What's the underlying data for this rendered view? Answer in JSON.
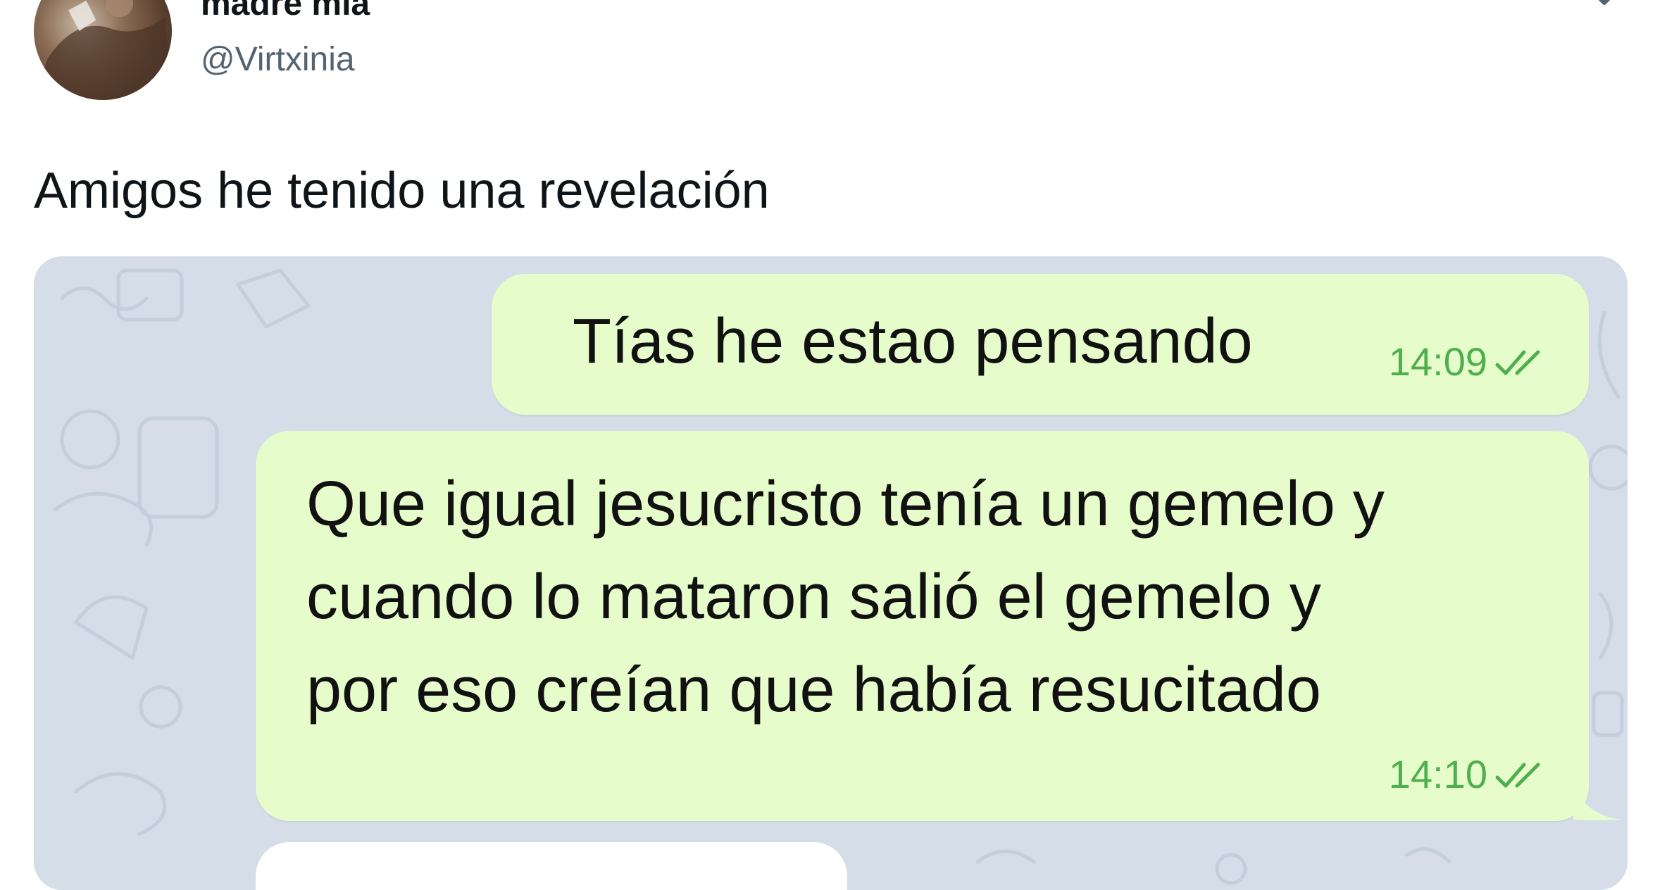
{
  "tweet": {
    "author": {
      "display_name": "madre mía",
      "handle": "@Virtxinia",
      "avatar_icon": "user-avatar"
    },
    "more_icon": "chevron-down-icon",
    "text": "Amigos he tenido una revelación"
  },
  "chat": {
    "background_color": "#d4dde8",
    "outgoing_bubble_color": "#e6fdcb",
    "incoming_bubble_color": "#ffffff",
    "status_color": "#4fae4e",
    "messages": [
      {
        "direction": "outgoing",
        "lines": [
          "Tías he estao pensando"
        ],
        "time": "14:09",
        "status_icon": "double-check-icon"
      },
      {
        "direction": "outgoing",
        "lines": [
          "Que igual jesucristo tenía un gemelo y",
          "cuando lo mataron salió el gemelo y",
          "por eso creían que había resucitado"
        ],
        "time": "14:10",
        "status_icon": "double-check-icon"
      },
      {
        "direction": "incoming",
        "lines": []
      }
    ]
  }
}
